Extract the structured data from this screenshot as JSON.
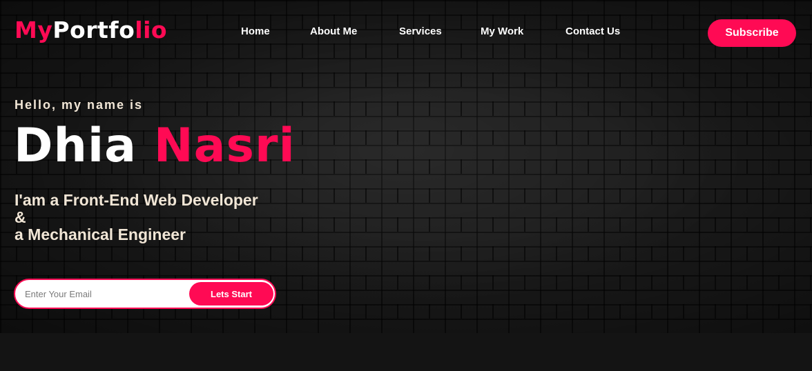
{
  "logo": {
    "part1": "My",
    "part2": "Portfo",
    "part3": "lio"
  },
  "nav": [
    {
      "label": "Home"
    },
    {
      "label": "About Me"
    },
    {
      "label": "Services"
    },
    {
      "label": "My Work"
    },
    {
      "label": "Contact Us"
    }
  ],
  "subscribe_label": "Subscribe",
  "hero": {
    "greeting": "Hello, my name is",
    "first_name": "Dhia",
    "last_name": "Nasri",
    "role_line1": "I'am a Front-End Web Developer",
    "role_line2": "&",
    "role_line3": "a Mechanical Engineer"
  },
  "email_form": {
    "placeholder": "Enter Your Email",
    "value": "",
    "button_label": "Lets Start"
  },
  "colors": {
    "accent": "#ff0a54",
    "text_light": "#f1e6d6",
    "background": "#141414"
  }
}
